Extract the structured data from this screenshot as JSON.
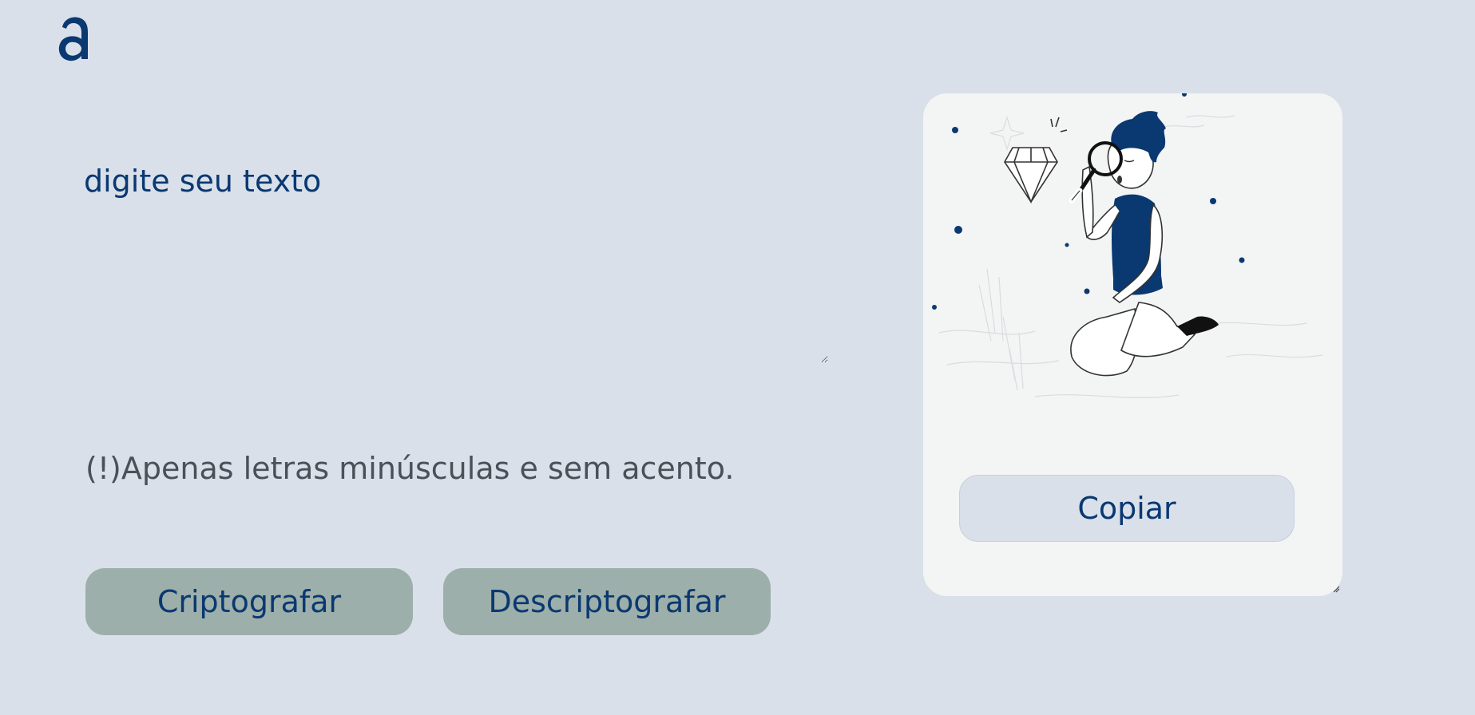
{
  "app": {
    "logo_letter": "a"
  },
  "input": {
    "placeholder": "digite seu texto",
    "value": ""
  },
  "hint": {
    "text": "(!)Apenas letras minúsculas e sem acento."
  },
  "actions": {
    "encrypt_label": "Criptografar",
    "decrypt_label": "Descriptografar"
  },
  "output": {
    "copy_label": "Copiar",
    "illustration": "person-with-magnifying-glass-and-diamond"
  },
  "colors": {
    "background": "#d9e0ea",
    "primary": "#0a3871",
    "button_gray": "#9dafaa",
    "panel": "#f3f4f4",
    "hint_text": "#495057"
  }
}
